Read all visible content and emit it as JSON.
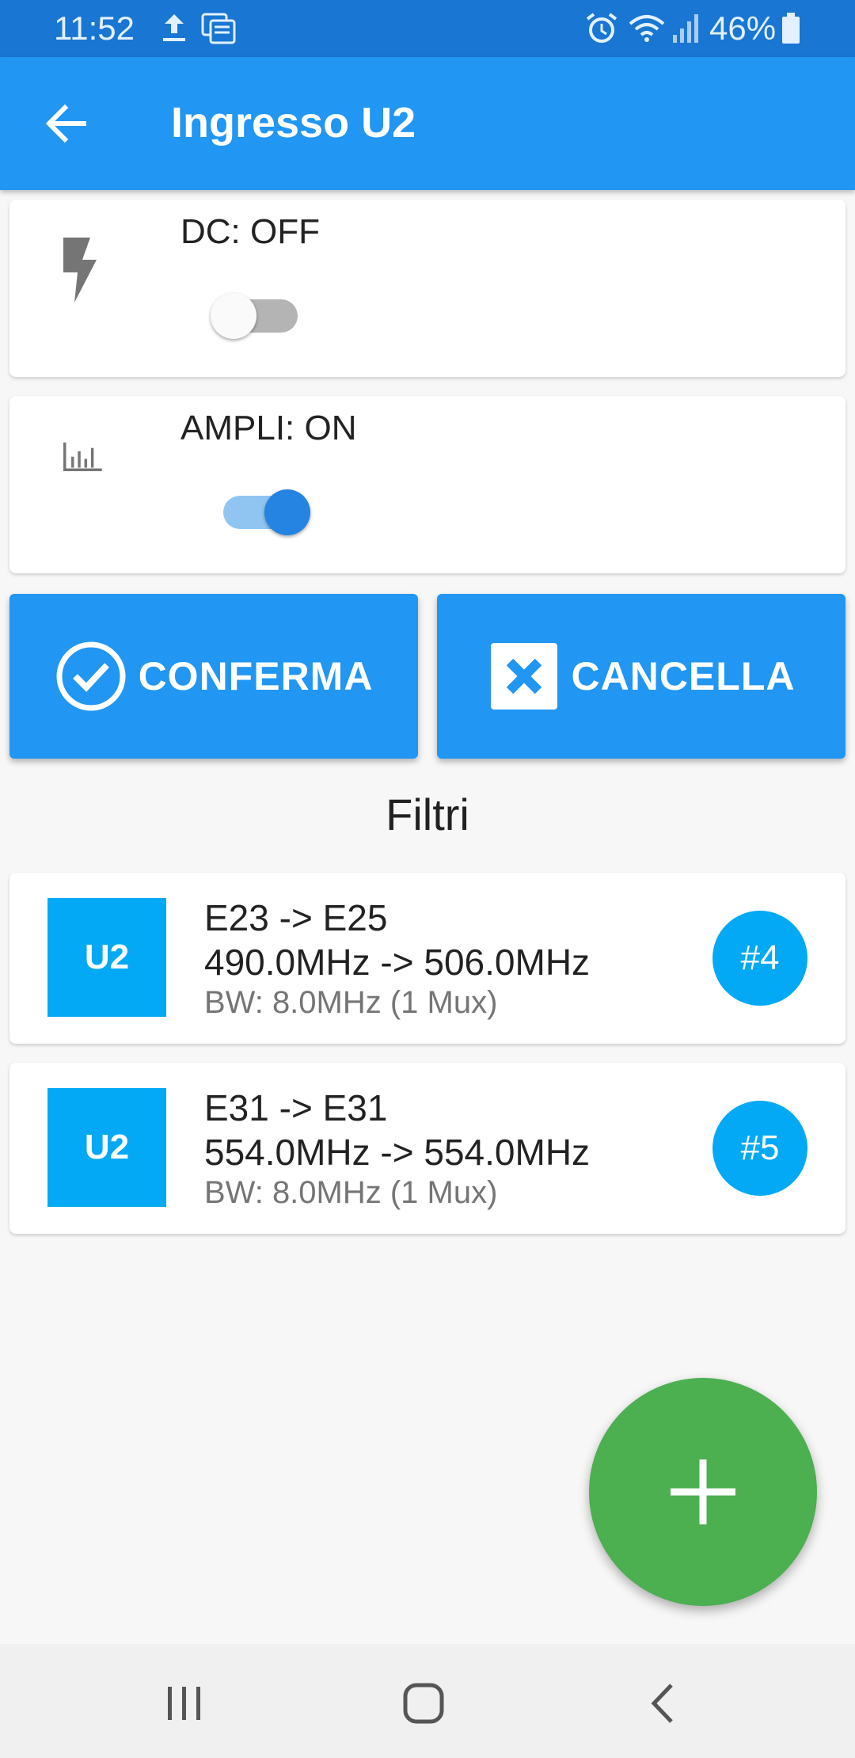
{
  "status_bar": {
    "time": "11:52",
    "battery": "46%",
    "icons": [
      "upload-icon",
      "notifications-icon",
      "alarm-icon",
      "wifi-icon",
      "signal-icon",
      "battery-icon"
    ]
  },
  "app_bar": {
    "title": "Ingresso U2",
    "back_icon": "arrow-back-icon"
  },
  "toggles": [
    {
      "label": "DC: OFF",
      "icon": "flash-icon",
      "state": false
    },
    {
      "label": "AMPLI: ON",
      "icon": "bar-chart-icon",
      "state": true
    }
  ],
  "actions": {
    "confirm_label": "CONFERMA",
    "cancel_label": "CANCELLA"
  },
  "filters_title": "Filtri",
  "filters": [
    {
      "tag": "U2",
      "channels": "E23 -> E25",
      "frequencies": "490.0MHz -> 506.0MHz",
      "bandwidth": "BW: 8.0MHz (1 Mux)",
      "number": "#4"
    },
    {
      "tag": "U2",
      "channels": "E31 -> E31",
      "frequencies": "554.0MHz -> 554.0MHz",
      "bandwidth": "BW: 8.0MHz (1 Mux)",
      "number": "#5"
    }
  ],
  "fab_icon": "add-icon",
  "colors": {
    "primary": "#2196f3",
    "status_bar": "#1976d2",
    "tag": "#03a9f4",
    "fab": "#4caf50"
  }
}
